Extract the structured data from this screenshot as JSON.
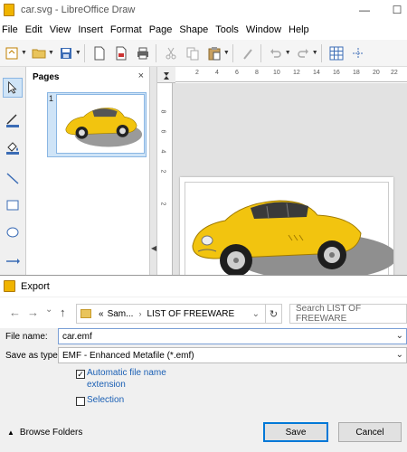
{
  "window": {
    "title": "car.svg - LibreOffice Draw",
    "min_symbol": "—",
    "max_symbol": "☐"
  },
  "menu": [
    {
      "label": "File"
    },
    {
      "label": "Edit"
    },
    {
      "label": "View"
    },
    {
      "label": "Insert"
    },
    {
      "label": "Format"
    },
    {
      "label": "Page"
    },
    {
      "label": "Shape"
    },
    {
      "label": "Tools"
    },
    {
      "label": "Window"
    },
    {
      "label": "Help"
    }
  ],
  "pages_pane": {
    "title": "Pages",
    "close_symbol": "×",
    "page_number": "1"
  },
  "ruler": {
    "h_ticks": [
      "2",
      "4",
      "6",
      "8",
      "10",
      "12",
      "14",
      "16",
      "18",
      "20",
      "22"
    ],
    "v_ticks": [
      "8",
      "6",
      "4",
      "2",
      "2"
    ]
  },
  "dialog": {
    "title": "Export",
    "nav": {
      "back": "←",
      "forward": "→",
      "dropdown": "⌄",
      "up": "↑"
    },
    "address": {
      "prefix": "«",
      "part1": "Sam...",
      "chev": "›",
      "part2": "LIST OF FREEWARE",
      "refresh": "↻"
    },
    "search_placeholder": "Search LIST OF FREEWARE",
    "filename_label": "File name:",
    "filename_value": "car.emf",
    "savetype_label": "Save as type:",
    "savetype_value": "EMF - Enhanced Metafile (*.emf)",
    "auto_ext": {
      "label1": "Automatic file name",
      "label2": "extension",
      "checked": true
    },
    "selection": {
      "label": "Selection",
      "checked": false
    },
    "browse_label": "Browse Folders",
    "save_label": "Save",
    "cancel_label": "Cancel",
    "check_mark": "✓",
    "dd_symbol": "⌄"
  },
  "colors": {
    "car_body": "#f2c40f",
    "selection_blue": "#cfe4f7",
    "accent": "#0078d7"
  }
}
